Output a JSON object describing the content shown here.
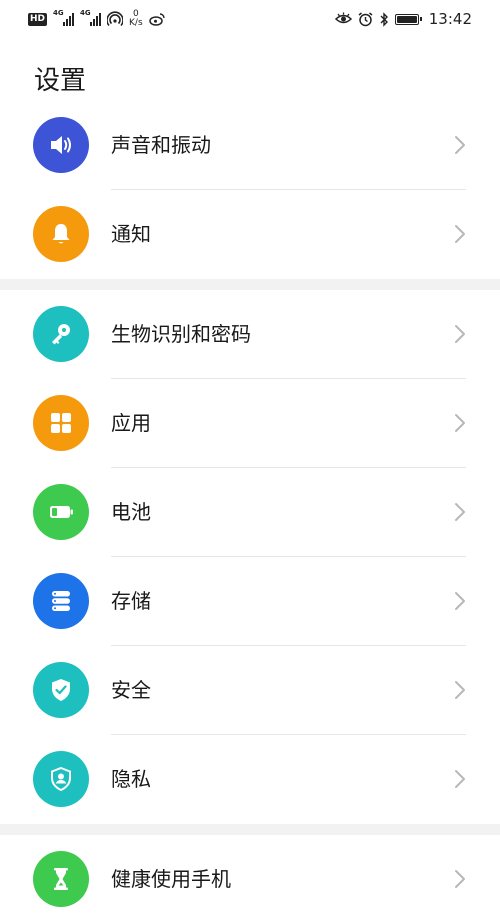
{
  "status_bar": {
    "hd_label": "HD",
    "sim1_tag": "4G",
    "sim2_tag": "4G",
    "speed_value": "0",
    "speed_unit": "K/s",
    "time": "13:42"
  },
  "page": {
    "title": "设置"
  },
  "groups": [
    {
      "items": [
        {
          "id": "sound",
          "label": "声音和振动",
          "icon": "speaker-icon",
          "color": "#3d54d6"
        },
        {
          "id": "notification",
          "label": "通知",
          "icon": "bell-icon",
          "color": "#f59a0c"
        }
      ]
    },
    {
      "items": [
        {
          "id": "biometrics",
          "label": "生物识别和密码",
          "icon": "key-icon",
          "color": "#1dbfbf"
        },
        {
          "id": "apps",
          "label": "应用",
          "icon": "apps-grid-icon",
          "color": "#f59a0c"
        },
        {
          "id": "battery",
          "label": "电池",
          "icon": "battery-icon",
          "color": "#3ec94f"
        },
        {
          "id": "storage",
          "label": "存储",
          "icon": "storage-icon",
          "color": "#1e73e8"
        },
        {
          "id": "security",
          "label": "安全",
          "icon": "shield-check-icon",
          "color": "#1dbfbf"
        },
        {
          "id": "privacy",
          "label": "隐私",
          "icon": "privacy-shield-icon",
          "color": "#1dbfbf"
        }
      ]
    },
    {
      "items": [
        {
          "id": "digital_balance",
          "label": "健康使用手机",
          "icon": "hourglass-icon",
          "color": "#3ec94f"
        }
      ]
    }
  ]
}
